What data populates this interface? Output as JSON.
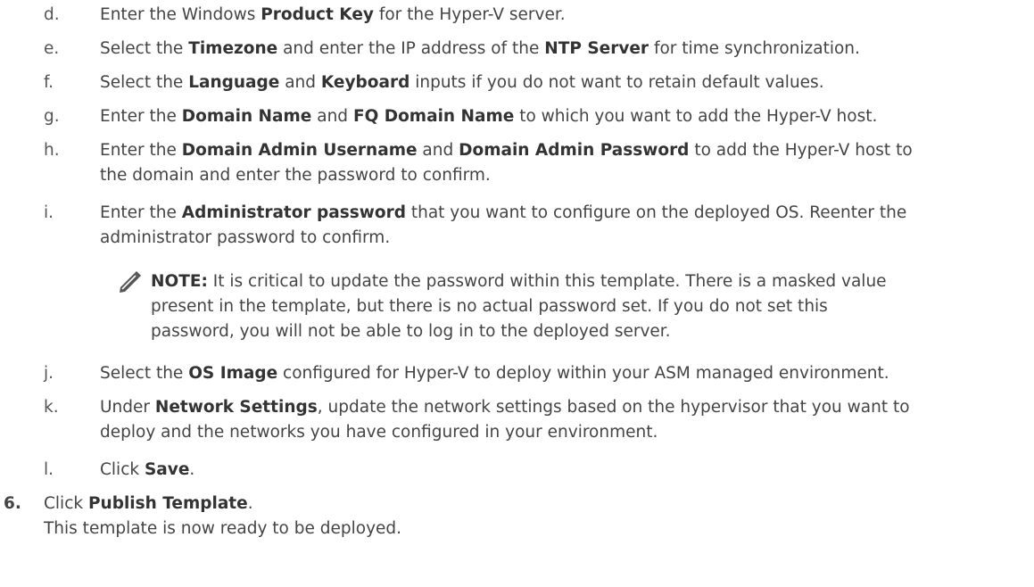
{
  "steps": {
    "d": {
      "label": "d.",
      "t1": "Enter the Windows ",
      "b1": "Product Key",
      "t2": " for the Hyper-V server."
    },
    "e": {
      "label": "e.",
      "t1": "Select the ",
      "b1": "Timezone",
      "t2": " and enter the IP address of the ",
      "b2": "NTP Server",
      "t3": " for time synchronization."
    },
    "f": {
      "label": "f.",
      "t1": "Select the ",
      "b1": "Language",
      "t2": " and ",
      "b2": "Keyboard",
      "t3": " inputs if you do not want to retain default values."
    },
    "g": {
      "label": "g.",
      "t1": "Enter the ",
      "b1": "Domain Name",
      "t2": " and ",
      "b2": "FQ Domain Name",
      "t3": " to which you want to add the Hyper-V host."
    },
    "h": {
      "label": "h.",
      "t1": "Enter the ",
      "b1": "Domain Admin Username",
      "t2": " and ",
      "b2": "Domain Admin Password",
      "t3": " to add the Hyper-V host to",
      "t4": "the domain and enter the password to confirm."
    },
    "i": {
      "label": "i.",
      "t1": "Enter the ",
      "b1": "Administrator password",
      "t2": " that you want to configure on the deployed OS. Reenter the",
      "t3": "administrator password to confirm."
    },
    "note": {
      "icon": "pencil-note-icon",
      "label": "NOTE:",
      "l1": " It is critical to update the password within this template. There is a masked value",
      "l2": "present in the template, but there is no actual password set. If you do not set this",
      "l3": "password, you will not be able to log in to the deployed server."
    },
    "j": {
      "label": "j.",
      "t1": "Select the ",
      "b1": "OS Image",
      "t2": " configured for Hyper-V to deploy within your ASM managed environment."
    },
    "k": {
      "label": "k.",
      "t1": "Under ",
      "b1": "Network Settings",
      "t2": ", update the network settings based on the hypervisor that you want to",
      "t3": "deploy and the networks you have configured in your environment."
    },
    "l": {
      "label": "l.",
      "t1": "Click ",
      "b1": "Save",
      "t2": "."
    },
    "s6": {
      "label": "6.",
      "t1": "Click ",
      "b1": "Publish Template",
      "t2": ".",
      "t3": "This template is now ready to be deployed."
    }
  }
}
